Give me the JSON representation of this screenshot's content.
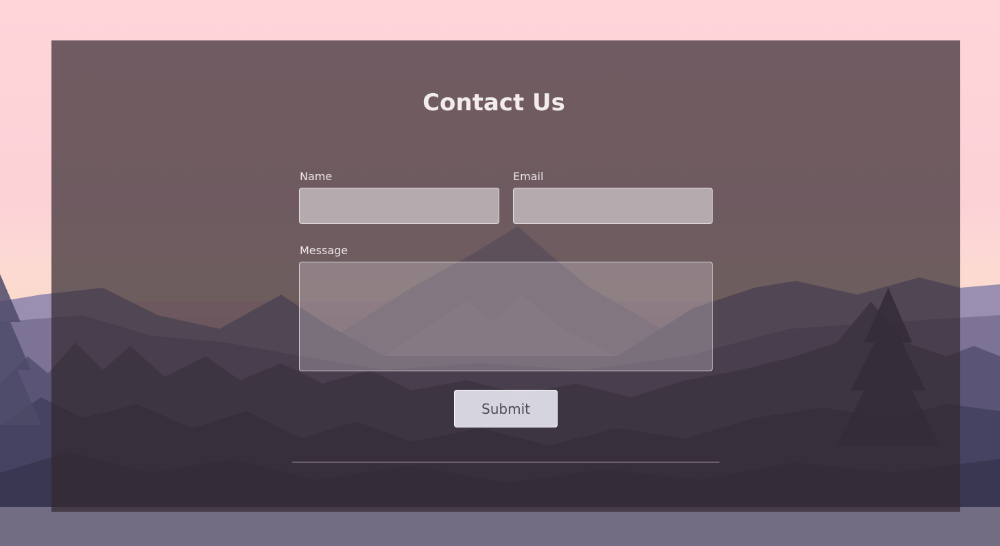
{
  "form": {
    "title": "Contact Us",
    "name_label": "Name",
    "name_value": "",
    "email_label": "Email",
    "email_value": "",
    "message_label": "Message",
    "message_value": "",
    "submit_label": "Submit"
  },
  "colors": {
    "sky_top": "#ffd6dc",
    "sky_bottom": "#f7c8cf",
    "panel_overlay": "#32282d",
    "mountain_far": "#8a7f9e",
    "forest": "#3f3c55",
    "text": "#f3ecec"
  }
}
